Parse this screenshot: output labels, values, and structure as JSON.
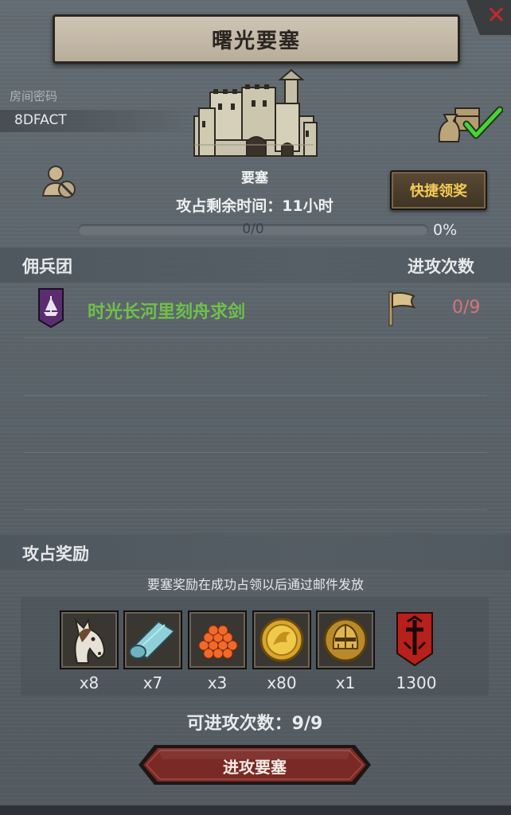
{
  "header": {
    "title": "曙光要塞"
  },
  "room": {
    "label": "房间密码",
    "code": "8DFACT"
  },
  "fortress": {
    "label": "要塞",
    "time_remaining": "攻占剩余时间：11小时",
    "progress_text": "0/0",
    "progress_percent_text": "0%",
    "progress_value": 0
  },
  "actions": {
    "quick_claim": "快捷领奖",
    "attack": "进攻要塞"
  },
  "guild_section": {
    "header": "佣兵团",
    "attacks_header": "进攻次数",
    "rows": [
      {
        "name": "时光长河里刻舟求剑",
        "attacks": "0/9"
      }
    ]
  },
  "rewards": {
    "header": "攻占奖励",
    "note": "要塞奖励在成功占领以后通过邮件发放",
    "items": [
      {
        "icon": "horse-icon",
        "qty": "x8"
      },
      {
        "icon": "cloth-icon",
        "qty": "x7"
      },
      {
        "icon": "roe-icon",
        "qty": "x3"
      },
      {
        "icon": "gold-coin-icon",
        "qty": "x80"
      },
      {
        "icon": "helmet-coin-icon",
        "qty": "x1"
      },
      {
        "icon": "shield-banner-icon",
        "qty": "1300"
      }
    ]
  },
  "attacks_available": "可进攻次数：9/9",
  "colors": {
    "guild_name": "#6fc04a",
    "attack_count": "#d7747b",
    "quick_claim_text": "#f5cc55",
    "attack_button": "#7a2a26"
  }
}
